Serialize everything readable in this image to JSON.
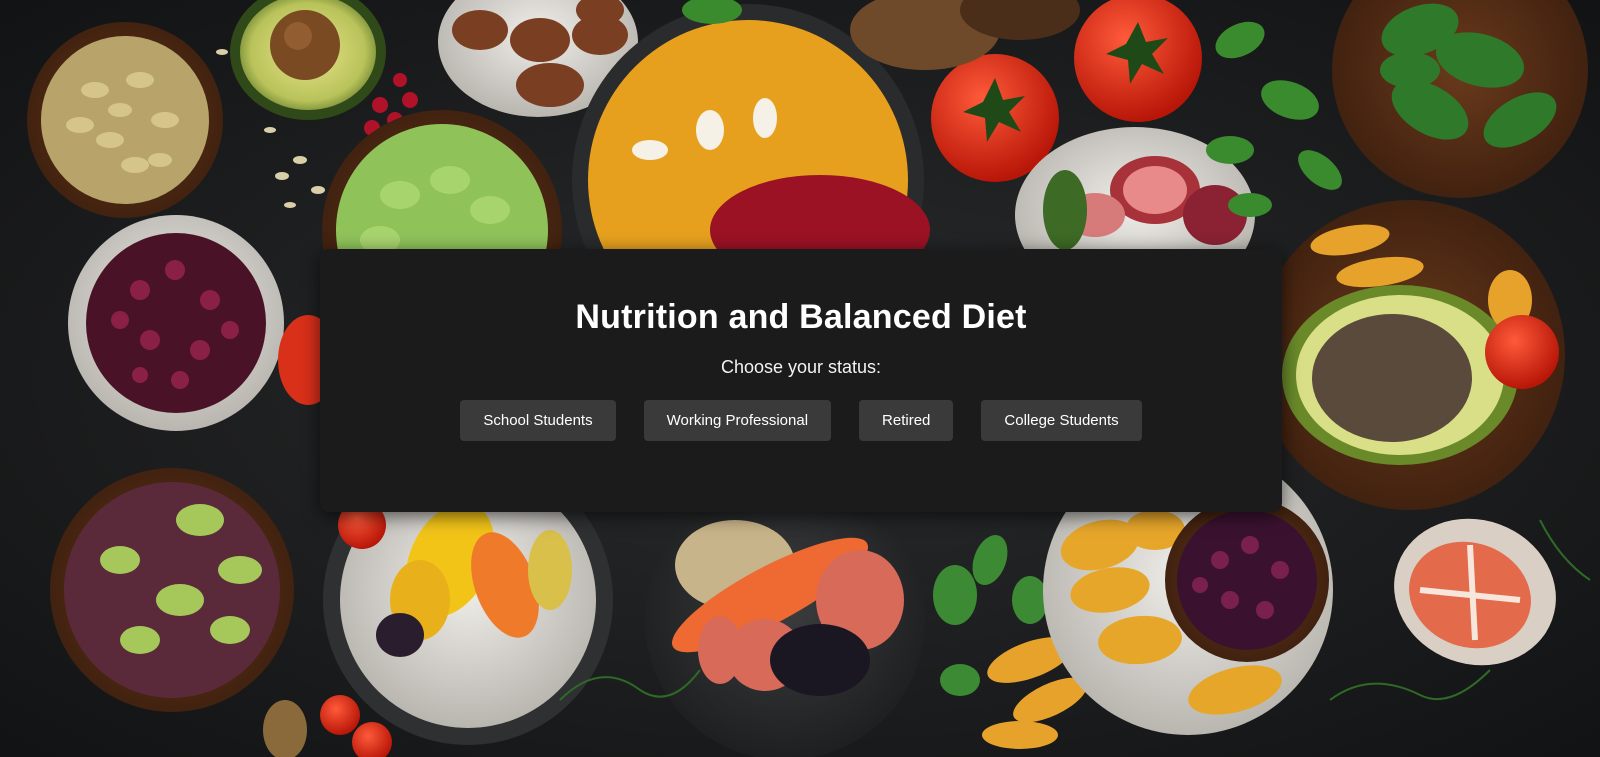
{
  "card": {
    "title": "Nutrition and Balanced Diet",
    "subtitle": "Choose your status:",
    "buttons": [
      {
        "label": "School Students"
      },
      {
        "label": "Working Professional"
      },
      {
        "label": "Retired"
      },
      {
        "label": "College Students"
      }
    ]
  },
  "colors": {
    "background": "#1c1d1e",
    "card": "#1b1b1b",
    "button": "#3a3a3a",
    "text": "#ffffff"
  }
}
